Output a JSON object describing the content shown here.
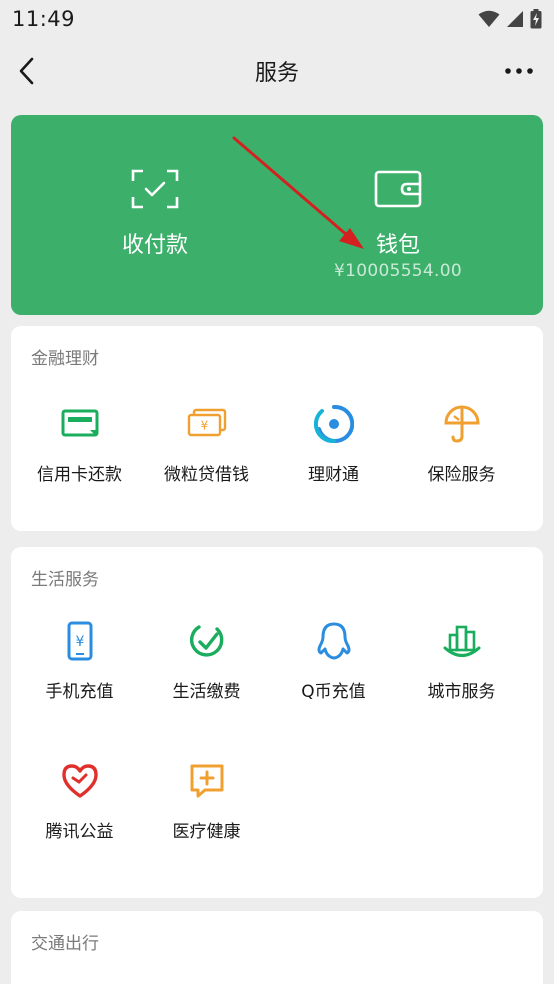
{
  "status_bar": {
    "time": "11:49"
  },
  "nav": {
    "title": "服务"
  },
  "green_card": {
    "pay_label": "收付款",
    "wallet_label": "钱包",
    "wallet_amount": "¥10005554.00"
  },
  "finance": {
    "title": "金融理财",
    "items": [
      {
        "label": "信用卡还款",
        "icon": "credit-card-icon"
      },
      {
        "label": "微粒贷借钱",
        "icon": "loan-icon"
      },
      {
        "label": "理财通",
        "icon": "wealth-icon"
      },
      {
        "label": "保险服务",
        "icon": "insurance-icon"
      }
    ]
  },
  "life": {
    "title": "生活服务",
    "items": [
      {
        "label": "手机充值",
        "icon": "phone-recharge-icon"
      },
      {
        "label": "生活缴费",
        "icon": "utility-bill-icon"
      },
      {
        "label": "Q币充值",
        "icon": "qq-coin-icon"
      },
      {
        "label": "城市服务",
        "icon": "city-service-icon"
      },
      {
        "label": "腾讯公益",
        "icon": "charity-icon"
      },
      {
        "label": "医疗健康",
        "icon": "medical-icon"
      }
    ]
  },
  "transport": {
    "title": "交通出行"
  },
  "colors": {
    "green": "#3cb06b",
    "finance_green": "#1aad5e",
    "orange": "#f0a030",
    "blue": "#2a8de0",
    "red": "#e0302c"
  }
}
